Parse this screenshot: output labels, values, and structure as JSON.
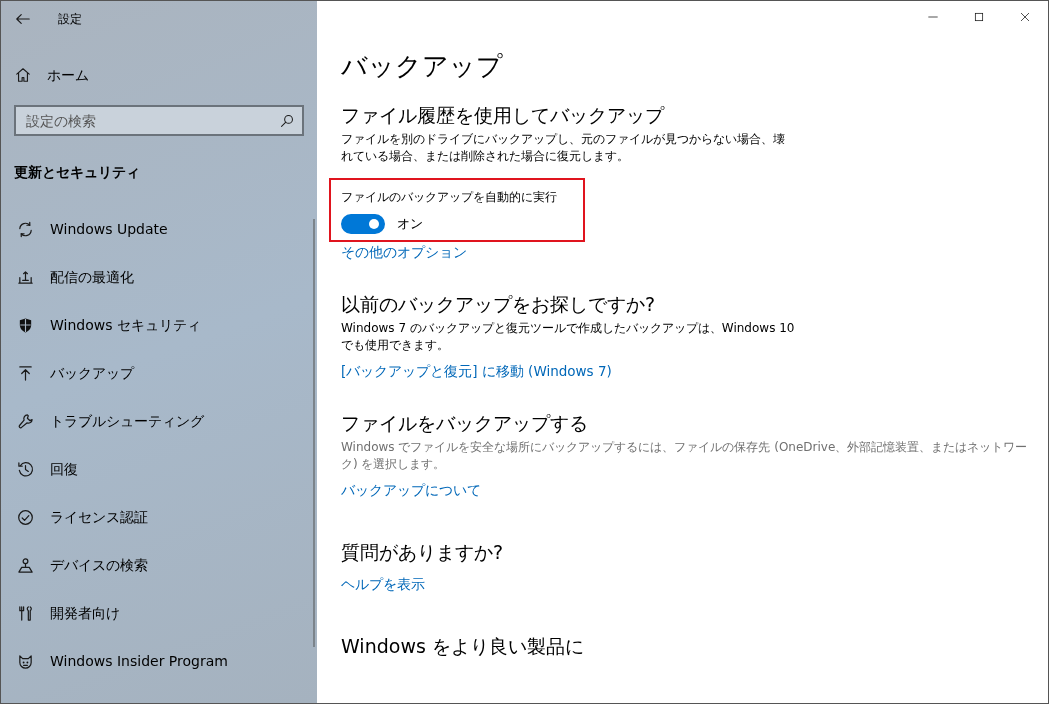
{
  "window": {
    "title": "設定"
  },
  "sidebar": {
    "home": "ホーム",
    "search": {
      "placeholder": "設定の検索"
    },
    "heading": "更新とセキュリティ",
    "items": [
      {
        "label": "Windows Update",
        "kind": "sync",
        "selected": false
      },
      {
        "label": "配信の最適化",
        "kind": "delivery",
        "selected": false
      },
      {
        "label": "Windows セキュリティ",
        "kind": "shield",
        "selected": false
      },
      {
        "label": "バックアップ",
        "kind": "upload",
        "selected": false
      },
      {
        "label": "トラブルシューティング",
        "kind": "wrench",
        "selected": false
      },
      {
        "label": "回復",
        "kind": "history",
        "selected": false
      },
      {
        "label": "ライセンス認証",
        "kind": "check",
        "selected": false
      },
      {
        "label": "デバイスの検索",
        "kind": "person",
        "selected": false
      },
      {
        "label": "開発者向け",
        "kind": "tools",
        "selected": false
      },
      {
        "label": "Windows Insider Program",
        "kind": "cat",
        "selected": false
      }
    ]
  },
  "page": {
    "title": "バックアップ",
    "sections": [
      {
        "kind": "file_history",
        "heading": "ファイル履歴を使用してバックアップ",
        "description": "ファイルを別のドライブにバックアップし、元のファイルが見つからない場合、壊れている場合、または削除された場合に復元します。",
        "dimmed": false,
        "toggle": {
          "label": "ファイルのバックアップを自動的に実行",
          "on": true,
          "state_text": "オン",
          "highlighted": true
        },
        "link": "その他のオプション"
      },
      {
        "kind": "legacy",
        "heading": "以前のバックアップをお探しですか?",
        "description": "Windows 7 のバックアップと復元ツールで作成したバックアップは、Windows 10 でも使用できます。",
        "dimmed": false,
        "link": "[バックアップと復元] に移動 (Windows 7)"
      },
      {
        "kind": "info",
        "heading": "ファイルをバックアップする",
        "description": "Windows でファイルを安全な場所にバックアップするには、ファイルの保存先 (OneDrive、外部記憶装置、またはネットワーク) を選択します。",
        "dimmed": true,
        "link": "バックアップについて"
      },
      {
        "kind": "help",
        "heading": "質問がありますか?",
        "link": "ヘルプを表示"
      },
      {
        "kind": "feedback",
        "heading": "Windows をより良い製品に"
      }
    ]
  }
}
